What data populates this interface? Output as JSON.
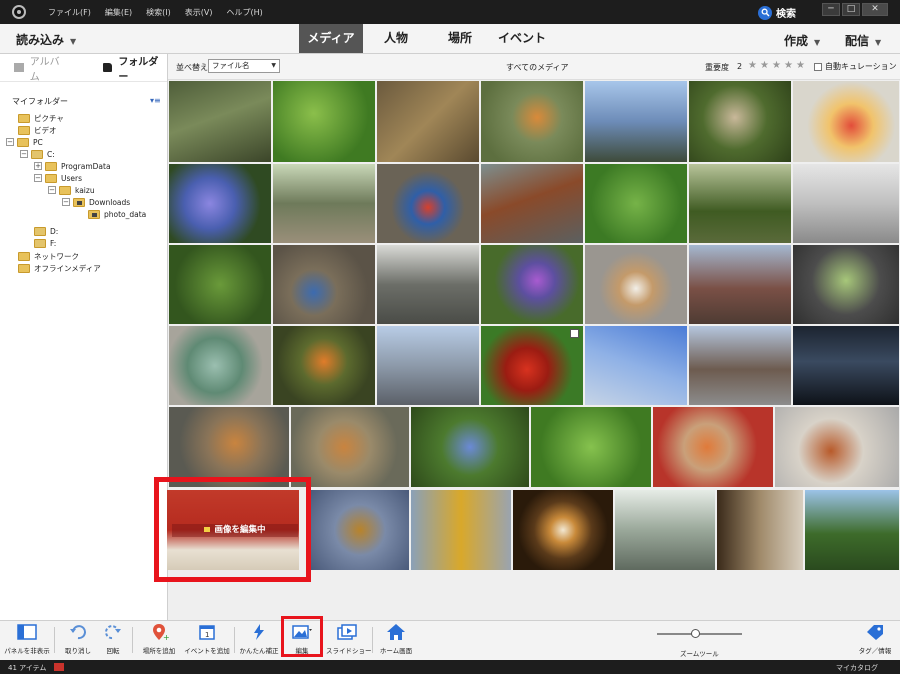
{
  "menu": {
    "items": [
      "ファイル(F)",
      "編集(E)",
      "検索(I)",
      "表示(V)",
      "ヘルプ(H)"
    ],
    "search_label": "検索"
  },
  "window_controls": {
    "minimize": "─",
    "maximize": "□",
    "close": "✕"
  },
  "topbar": {
    "import_label": "読み込み",
    "tabs": [
      "メディア",
      "人物",
      "場所",
      "イベント"
    ],
    "active_tab": "メディア",
    "create_label": "作成",
    "share_label": "配信"
  },
  "panel": {
    "tab_album": "アルバム",
    "tab_folder": "フォルダー",
    "my_folders": "マイフォルダー",
    "tree_options_icon": "list-options-icon",
    "tree": [
      {
        "label": "ピクチャ",
        "expander": ""
      },
      {
        "label": "ビデオ",
        "expander": ""
      },
      {
        "label": "PC",
        "expander": "⊟"
      },
      {
        "label": "C:",
        "expander": "⊟"
      },
      {
        "label": "ProgramData",
        "expander": "⊞"
      },
      {
        "label": "Users",
        "expander": "⊟"
      },
      {
        "label": "kaizu",
        "expander": "⊟"
      },
      {
        "label": "Downloads",
        "expander": "⊟"
      },
      {
        "label": "photo_data",
        "expander": ""
      },
      {
        "label": "D:",
        "expander": ""
      },
      {
        "label": "F:",
        "expander": ""
      },
      {
        "label": "ネットワーク",
        "expander": ""
      },
      {
        "label": "オフラインメディア",
        "expander": ""
      }
    ]
  },
  "sortbar": {
    "sort_label": "並べ替え",
    "sort_value": "ファイル名",
    "title": "すべてのメディア",
    "rating_label": "重要度",
    "rating_value": "2",
    "stars": 5,
    "auto_curate": "自動キュレーション"
  },
  "highlight": {
    "editing_label": "画像を編集中"
  },
  "toolbar": {
    "panel_toggle": "パネルを非表示",
    "undo": "取り消し",
    "rotate": "回転",
    "add_place": "場所を追加",
    "add_event": "イベントを追加",
    "quick_fix": "かんたん補正",
    "edit": "編集",
    "slideshow": "スライドショー",
    "home": "ホーム画面",
    "zoom": "ズームツール",
    "zoom_level": 0.45,
    "tags": "タグ／情報"
  },
  "status": {
    "item_count": "41 アイテム",
    "catalog": "マイカタログ"
  },
  "colors": {
    "accent_red": "#e8141c",
    "active_tab_bg": "#555555",
    "folder_yellow": "#e8c25b",
    "search_blue": "#2a6fd6"
  }
}
